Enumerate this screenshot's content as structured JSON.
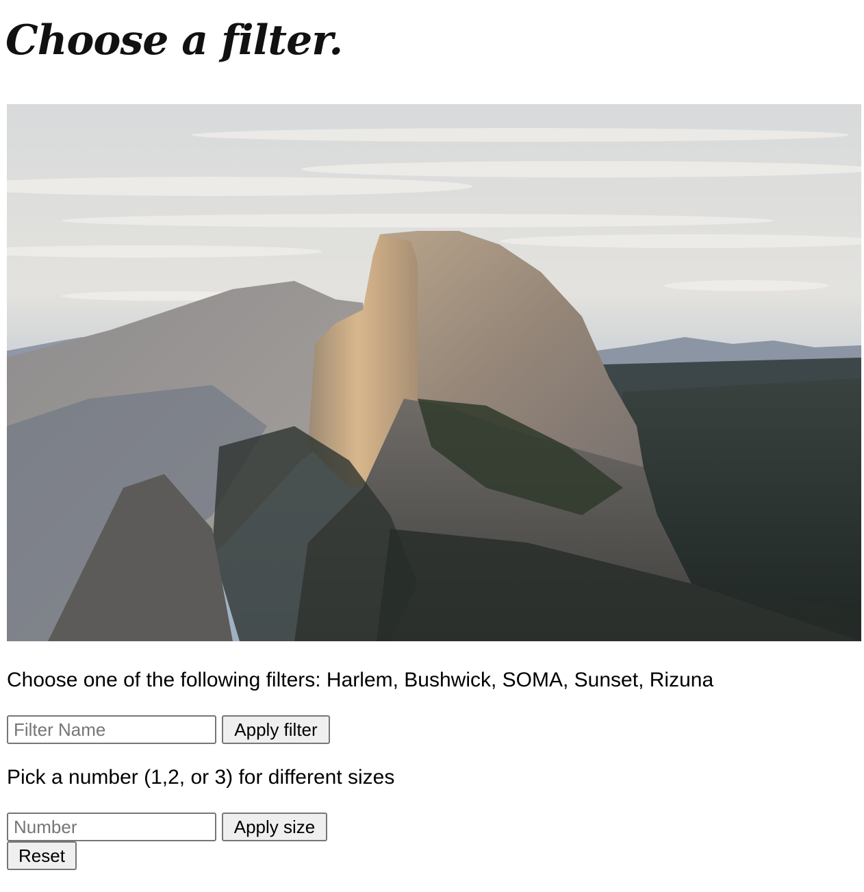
{
  "page": {
    "title": "Choose a filter."
  },
  "image": {
    "alt": ""
  },
  "filter_section": {
    "instructions": "Choose one of the following filters: Harlem, Bushwick, SOMA, Sunset, Rizuna",
    "input_value": "",
    "input_placeholder": "Filter Name",
    "apply_label": "Apply filter"
  },
  "size_section": {
    "instructions": "Pick a number (1,2, or 3) for different sizes",
    "input_value": "",
    "input_placeholder": "Number",
    "apply_label": "Apply size"
  },
  "reset": {
    "label": "Reset"
  },
  "colors": {
    "button_background": "#efefef",
    "button_border": "#767676",
    "placeholder_text": "#757575"
  }
}
